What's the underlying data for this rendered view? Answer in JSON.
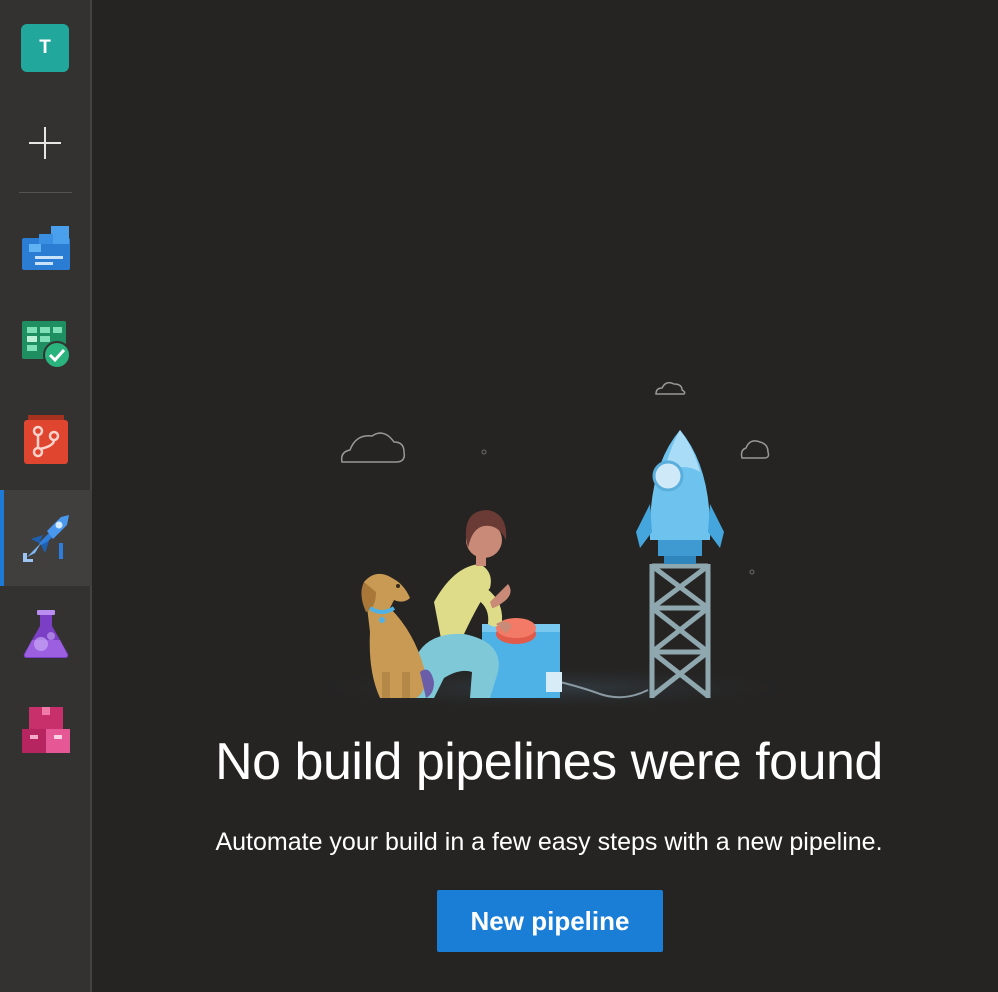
{
  "sidebar": {
    "org_initial": "T",
    "add_icon": "plus-icon",
    "items": [
      {
        "id": "overview",
        "icon": "overview-icon",
        "color": "#2b7cd3"
      },
      {
        "id": "boards",
        "icon": "boards-icon",
        "color": "#2aa67a"
      },
      {
        "id": "repos",
        "icon": "repos-icon",
        "color": "#e0452f"
      },
      {
        "id": "pipelines",
        "icon": "pipelines-icon",
        "color": "#2f7ddb",
        "active": true
      },
      {
        "id": "test-plans",
        "icon": "test-plans-icon",
        "color": "#7a3fc4"
      },
      {
        "id": "artifacts",
        "icon": "artifacts-icon",
        "color": "#c8306c"
      }
    ]
  },
  "empty_state": {
    "illustration": "rocket-launch-illustration",
    "heading": "No build pipelines were found",
    "subheading": "Automate your build in a few easy steps with a new pipeline.",
    "button_label": "New pipeline"
  },
  "colors": {
    "background": "#252423",
    "sidebar": "#333231",
    "accent": "#1b7ed6",
    "avatar": "#21a79b"
  }
}
